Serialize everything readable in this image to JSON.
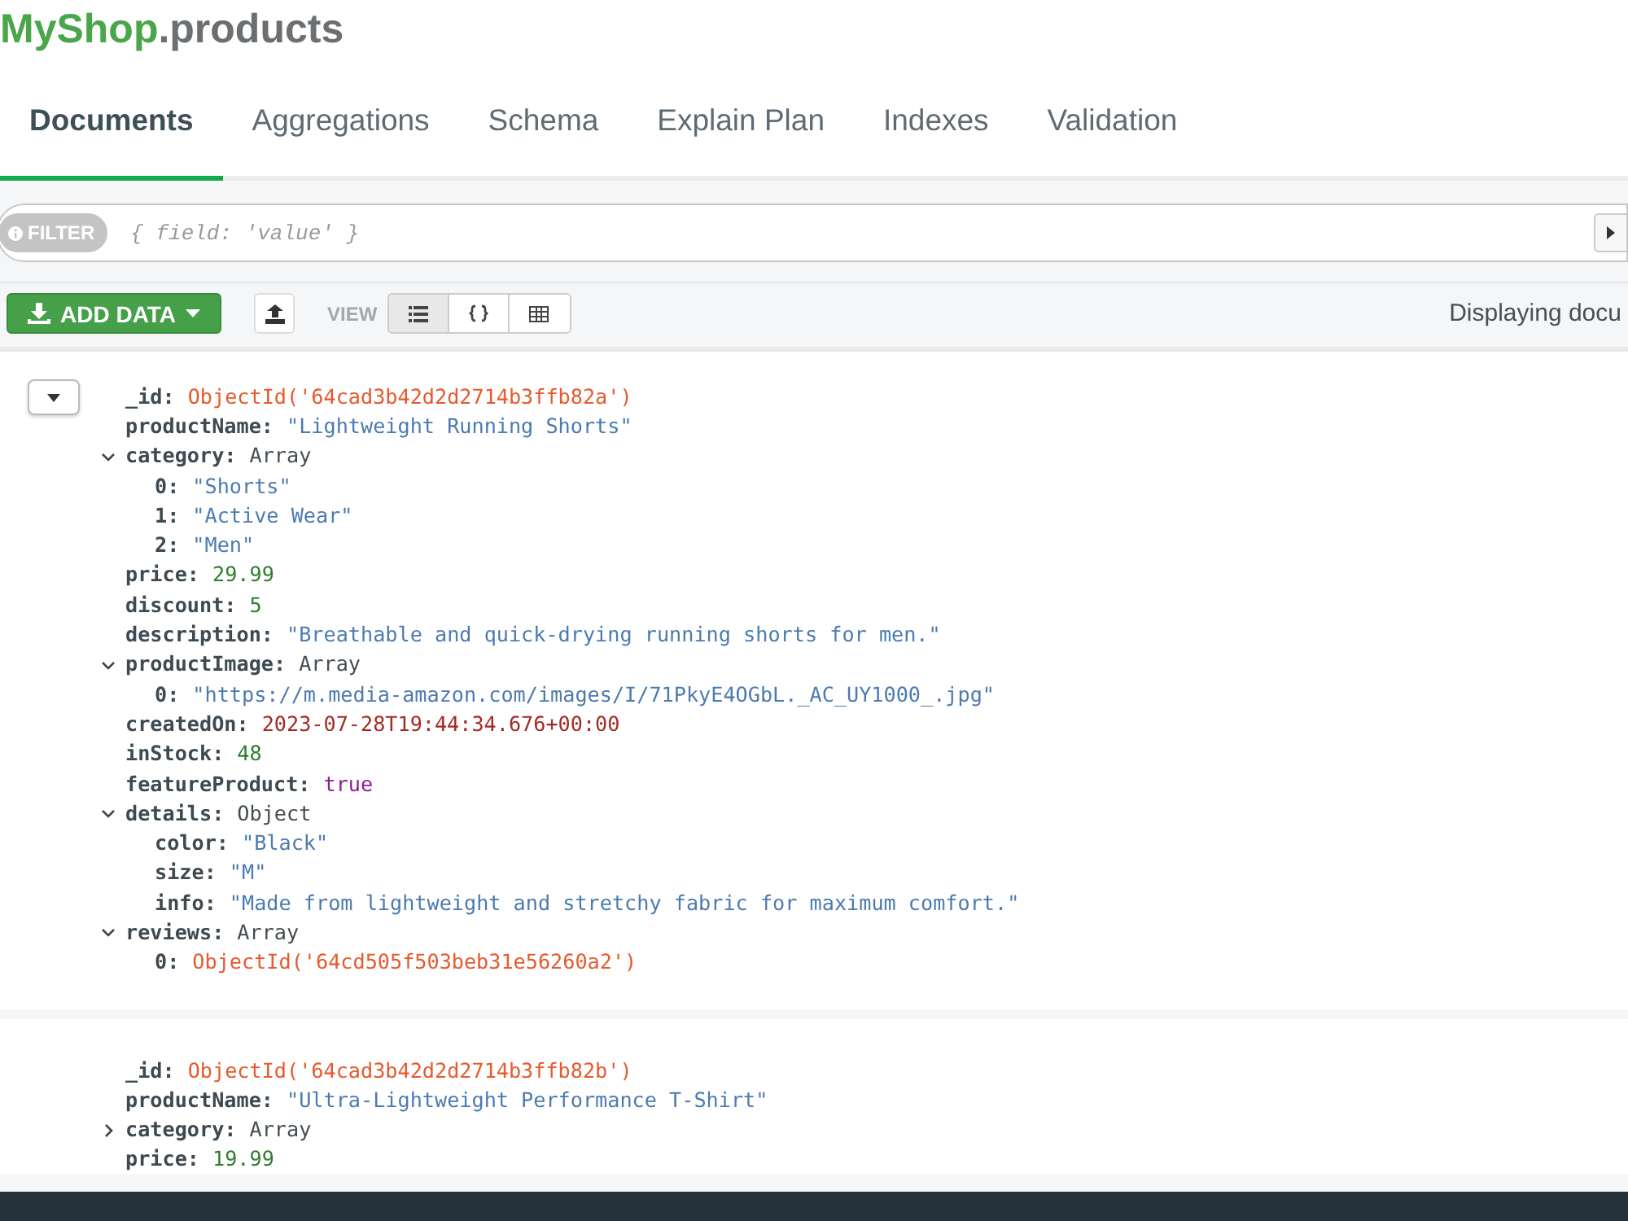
{
  "title": {
    "database": "MyShop",
    "collection": ".products"
  },
  "tabs": [
    {
      "label": "Documents",
      "selected": true
    },
    {
      "label": "Aggregations",
      "selected": false
    },
    {
      "label": "Schema",
      "selected": false
    },
    {
      "label": "Explain Plan",
      "selected": false
    },
    {
      "label": "Indexes",
      "selected": false
    },
    {
      "label": "Validation",
      "selected": false
    }
  ],
  "filter": {
    "label": "FILTER",
    "placeholder": "{ field: 'value' }"
  },
  "toolbar": {
    "add_data": "ADD DATA",
    "view_label": "VIEW",
    "views": [
      {
        "kind": "list",
        "selected": true
      },
      {
        "kind": "json",
        "selected": false
      },
      {
        "kind": "table",
        "selected": false
      }
    ],
    "status": "Displaying docu"
  },
  "documents": [
    {
      "expanded": true,
      "fields": [
        {
          "key": "_id:",
          "kind": "objectid",
          "value": "ObjectId('64cad3b42d2d2714b3ffb82a')"
        },
        {
          "key": "productName:",
          "kind": "string",
          "value": "\"Lightweight Running Shorts\""
        },
        {
          "key": "category:",
          "kind": "label",
          "value": "Array",
          "expanded": true,
          "children": [
            {
              "key": "0:",
              "kind": "string",
              "value": "\"Shorts\""
            },
            {
              "key": "1:",
              "kind": "string",
              "value": "\"Active Wear\""
            },
            {
              "key": "2:",
              "kind": "string",
              "value": "\"Men\""
            }
          ]
        },
        {
          "key": "price:",
          "kind": "number",
          "value": "29.99"
        },
        {
          "key": "discount:",
          "kind": "number",
          "value": "5"
        },
        {
          "key": "description:",
          "kind": "string",
          "value": "\"Breathable and quick-drying running shorts for men.\""
        },
        {
          "key": "productImage:",
          "kind": "label",
          "value": "Array",
          "expanded": true,
          "children": [
            {
              "key": "0:",
              "kind": "string",
              "value": "\"https://m.media-amazon.com/images/I/71PkyE4OGbL._AC_UY1000_.jpg\""
            }
          ]
        },
        {
          "key": "createdOn:",
          "kind": "date",
          "value": "2023-07-28T19:44:34.676+00:00"
        },
        {
          "key": "inStock:",
          "kind": "number",
          "value": "48"
        },
        {
          "key": "featureProduct:",
          "kind": "boolean",
          "value": "true"
        },
        {
          "key": "details:",
          "kind": "label",
          "value": "Object",
          "expanded": true,
          "children": [
            {
              "key": "color:",
              "kind": "string",
              "value": "\"Black\""
            },
            {
              "key": "size:",
              "kind": "string",
              "value": "\"M\""
            },
            {
              "key": "info:",
              "kind": "string",
              "value": "\"Made from lightweight and stretchy fabric for maximum comfort.\""
            }
          ]
        },
        {
          "key": "reviews:",
          "kind": "label",
          "value": "Array",
          "expanded": true,
          "children": [
            {
              "key": "0:",
              "kind": "objectid",
              "value": "ObjectId('64cd505f503beb31e56260a2')"
            }
          ]
        }
      ]
    },
    {
      "fields": [
        {
          "key": "_id:",
          "kind": "objectid",
          "value": "ObjectId('64cad3b42d2d2714b3ffb82b')"
        },
        {
          "key": "productName:",
          "kind": "string",
          "value": "\"Ultra-Lightweight Performance T-Shirt\""
        },
        {
          "key": "category:",
          "kind": "label",
          "value": "Array",
          "expanded": false
        },
        {
          "key": "price:",
          "kind": "number",
          "value": "19.99"
        }
      ]
    }
  ]
}
